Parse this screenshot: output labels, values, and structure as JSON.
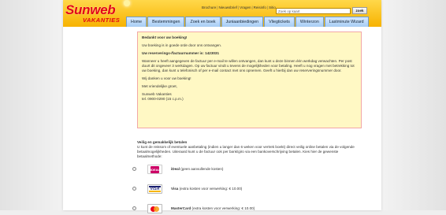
{
  "header": {
    "logo_main": "Sunweb",
    "logo_sub": "VAKANTIES",
    "top_links": [
      "Brochure",
      "Nieuwsbrief",
      "Vragen",
      "Reisinfo",
      "Sitio"
    ],
    "search_placeholder": "Zoek op kaart",
    "search_button": "zoek"
  },
  "nav": {
    "tabs": [
      "Home",
      "Bestemmingen",
      "Zoek en boek",
      "Juniaanbiedingen",
      "Vliegtickets",
      "Winterzon",
      "Lastminute Wizard"
    ]
  },
  "notice": {
    "title": "Bedankt voor uw boeking!",
    "line1": "Uw boeking is in goede orde door ons ontvangen.",
    "reservation": "Uw reserverings-/factuurnummer is: 1423031",
    "para1": "Wanneer u heeft aangegeven de factuur per e-mail te willen ontvangen, dan kunt u deze binnen één werkdag verwachten. Per post duurt dit ongeveer 3 werkdagen. Op uw factuur vindt u tevens de mogelijkheden voor betaling. Heeft u nog vragen met betrekking tot uw boeking, dan kunt u telefonisch of per e-mail contact met ons opnemen. Geeft u hierbij dan uw reserveringsnummer door.",
    "para2": "Wij danken u voor uw boeking!",
    "closing": "Met vriendelijke groet,",
    "company": "Sunweb Vakanties",
    "phone": "tel. 0900-0290 (15 c.p.m.)"
  },
  "payment": {
    "title": "Veilig en gemakkelijk betalen",
    "intro": "U kunt de reissom of eventuele aanbetaling (indien u langer dan 6 weken voor vertrek boekt) direct veilig online betalen via de volgende betaalmogelijkheden. Uiteraard kunt u de factuur ook per bank/giro via een bankoverschrijving betalen. Kies hier de gewenste betaalmethode:",
    "options": [
      {
        "name": "iDeal",
        "detail": " (geen aanvullende kosten)",
        "logo_text": "iDEAL"
      },
      {
        "name": "Visa",
        "detail": " (extra kosten voor verwerking: € 10.00)",
        "logo_text": "VISA"
      },
      {
        "name": "MasterCard",
        "detail": " (extra kosten voor verwerking: € 10.00)",
        "logo_text": ""
      }
    ]
  },
  "colors": {
    "header_top": "#ffd84a",
    "header_bottom": "#f7b200",
    "brand_red": "#e30613",
    "notice_bg": "#fff8c4",
    "notice_border": "#f3a6a6",
    "tab_bg": "#a7cdf4"
  }
}
